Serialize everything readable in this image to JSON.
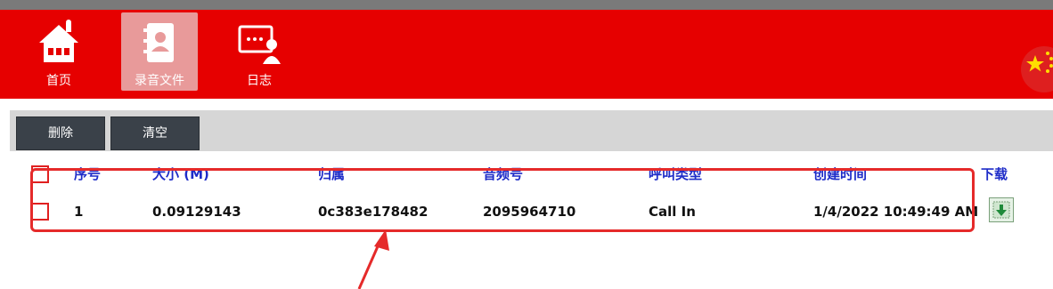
{
  "nav": [
    {
      "label": "首页",
      "icon": "home-icon"
    },
    {
      "label": "录音文件",
      "icon": "contacts-book-icon",
      "active": true
    },
    {
      "label": "日志",
      "icon": "log-user-icon"
    }
  ],
  "toolbar": {
    "delete_label": "删除",
    "clear_label": "清空"
  },
  "table": {
    "headers": [
      "序号",
      "大小 (M)",
      "归属",
      "音频号",
      "呼叫类型",
      "创建时间",
      "下载"
    ],
    "rows": [
      {
        "index": "1",
        "size": "0.09129143",
        "owner": "0c383e178482",
        "audio_no": "2095964710",
        "call_type": "Call In",
        "created": "1/4/2022 10:49:49 AM"
      }
    ]
  },
  "colors": {
    "nav_bg": "#e60000",
    "header_text": "#1e2cc8",
    "annotation": "#e52a2a"
  }
}
